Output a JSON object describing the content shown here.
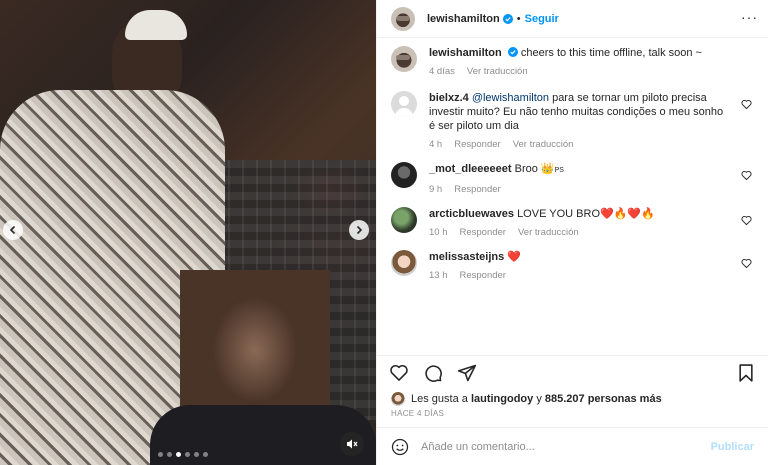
{
  "post": {
    "author": "lewishamilton",
    "follow_label": "Seguir",
    "more_icon": "more-icon",
    "caption_text": "cheers to this time offline, talk soon ~",
    "caption_time": "4 días",
    "caption_translate": "Ver traducción"
  },
  "comments": [
    {
      "user": "bielxz.4",
      "mention": "@lewishamilton",
      "text": " para se tornar um piloto precisa investir muito? Eu não tenho muitas condições o meu sonho é ser piloto um dia",
      "time": "4 h",
      "reply": "Responder",
      "translate": "Ver traducción"
    },
    {
      "user": "_mot_dleeeeeet",
      "text": "Broo 👑",
      "text_suffix": "PS",
      "time": "9 h",
      "reply": "Responder"
    },
    {
      "user": "arcticbluewaves",
      "text": "LOVE YOU BRO❤️🔥❤️🔥",
      "time": "10 h",
      "reply": "Responder",
      "translate": "Ver traducción"
    },
    {
      "user": "melissasteijns",
      "text": "❤️",
      "time": "13 h",
      "reply": "Responder"
    }
  ],
  "likes": {
    "prefix": "Les gusta a",
    "liker": "lautingodoy",
    "connector": "y",
    "count": "885.207 personas más"
  },
  "posted_ago": "HACE 4 DÍAS",
  "add_comment": {
    "placeholder": "Añade un comentario...",
    "publish_label": "Publicar"
  },
  "carousel": {
    "total_slides": 6,
    "active_index": 2
  },
  "colors": {
    "accent": "#0095f6",
    "publish_disabled": "#b2dffc",
    "secondary_text": "#8e8e8e"
  }
}
